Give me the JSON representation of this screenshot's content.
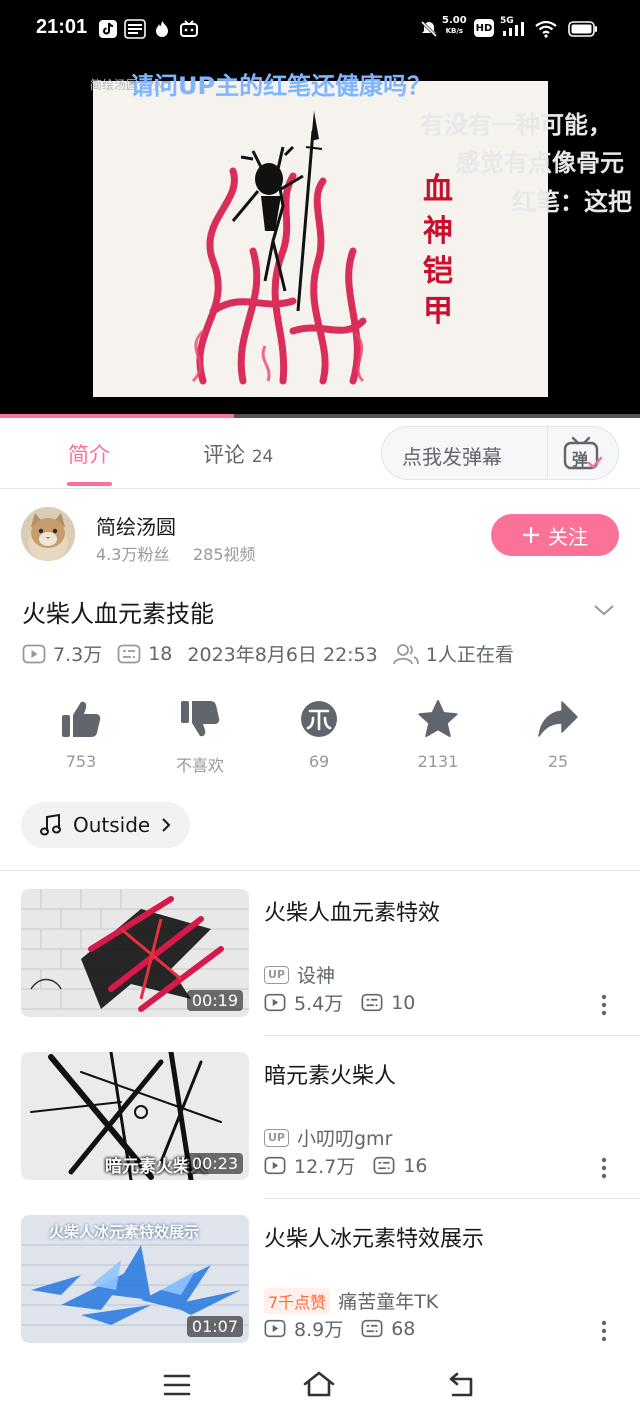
{
  "status_bar": {
    "time": "21:01",
    "network_speed_value": "5.00",
    "network_speed_unit": "KB/s",
    "signal_label": "5G",
    "hd_label": "HD"
  },
  "video": {
    "artwork_text": "血神铠甲",
    "danmaku": [
      "请问UP主的红笔还健康吗？",
      "有没有一种可能，",
      "感觉有点像骨元",
      "红笔：这把"
    ],
    "overlay_small_text": "简绘汤圆 · 小·",
    "progress_fraction": 0.365
  },
  "tabs": {
    "intro_label": "简介",
    "comments_label": "评论",
    "comments_count": "24",
    "danmaku_placeholder": "点我发弹幕",
    "danmaku_button_label": "弹"
  },
  "uploader": {
    "name": "简绘汤圆",
    "fans": "4.3万粉丝",
    "videos": "285视频",
    "follow_label": "关注"
  },
  "video_info": {
    "title": "火柴人血元素技能",
    "views": "7.3万",
    "danmaku_count": "18",
    "date": "2023年8月6日 22:53",
    "watching": "1人正在看"
  },
  "actions": {
    "like": "753",
    "dislike": "不喜欢",
    "coin": "69",
    "favorite": "2131",
    "share": "25"
  },
  "music": {
    "label": "Outside"
  },
  "recommendations": [
    {
      "title": "火柴人血元素特效",
      "duration": "00:19",
      "author": "设神",
      "views": "5.4万",
      "danmaku": "10",
      "badge": "UP"
    },
    {
      "title": "暗元素火柴人",
      "duration": "00:23",
      "thumb_caption": "暗元素火柴人",
      "author": "小叨叨gmr",
      "views": "12.7万",
      "danmaku": "16",
      "badge": "UP"
    },
    {
      "title": "火柴人冰元素特效展示",
      "duration": "01:07",
      "thumb_caption": "火柴人冰元素特效展示",
      "author": "痛苦童年TK",
      "views": "8.9万",
      "danmaku": "68",
      "badge": "7千点赞"
    }
  ],
  "colors": {
    "accent_pink": "#fb7299",
    "text_primary": "#18191c",
    "text_secondary": "#61666d",
    "text_muted": "#9499a0",
    "hot_badge": "#ff6a3d"
  },
  "icons": {
    "nav": [
      "menu-icon",
      "home-icon",
      "back-icon"
    ],
    "actions": [
      "thumb-up-icon",
      "thumb-down-icon",
      "coin-icon",
      "star-icon",
      "share-icon"
    ]
  }
}
